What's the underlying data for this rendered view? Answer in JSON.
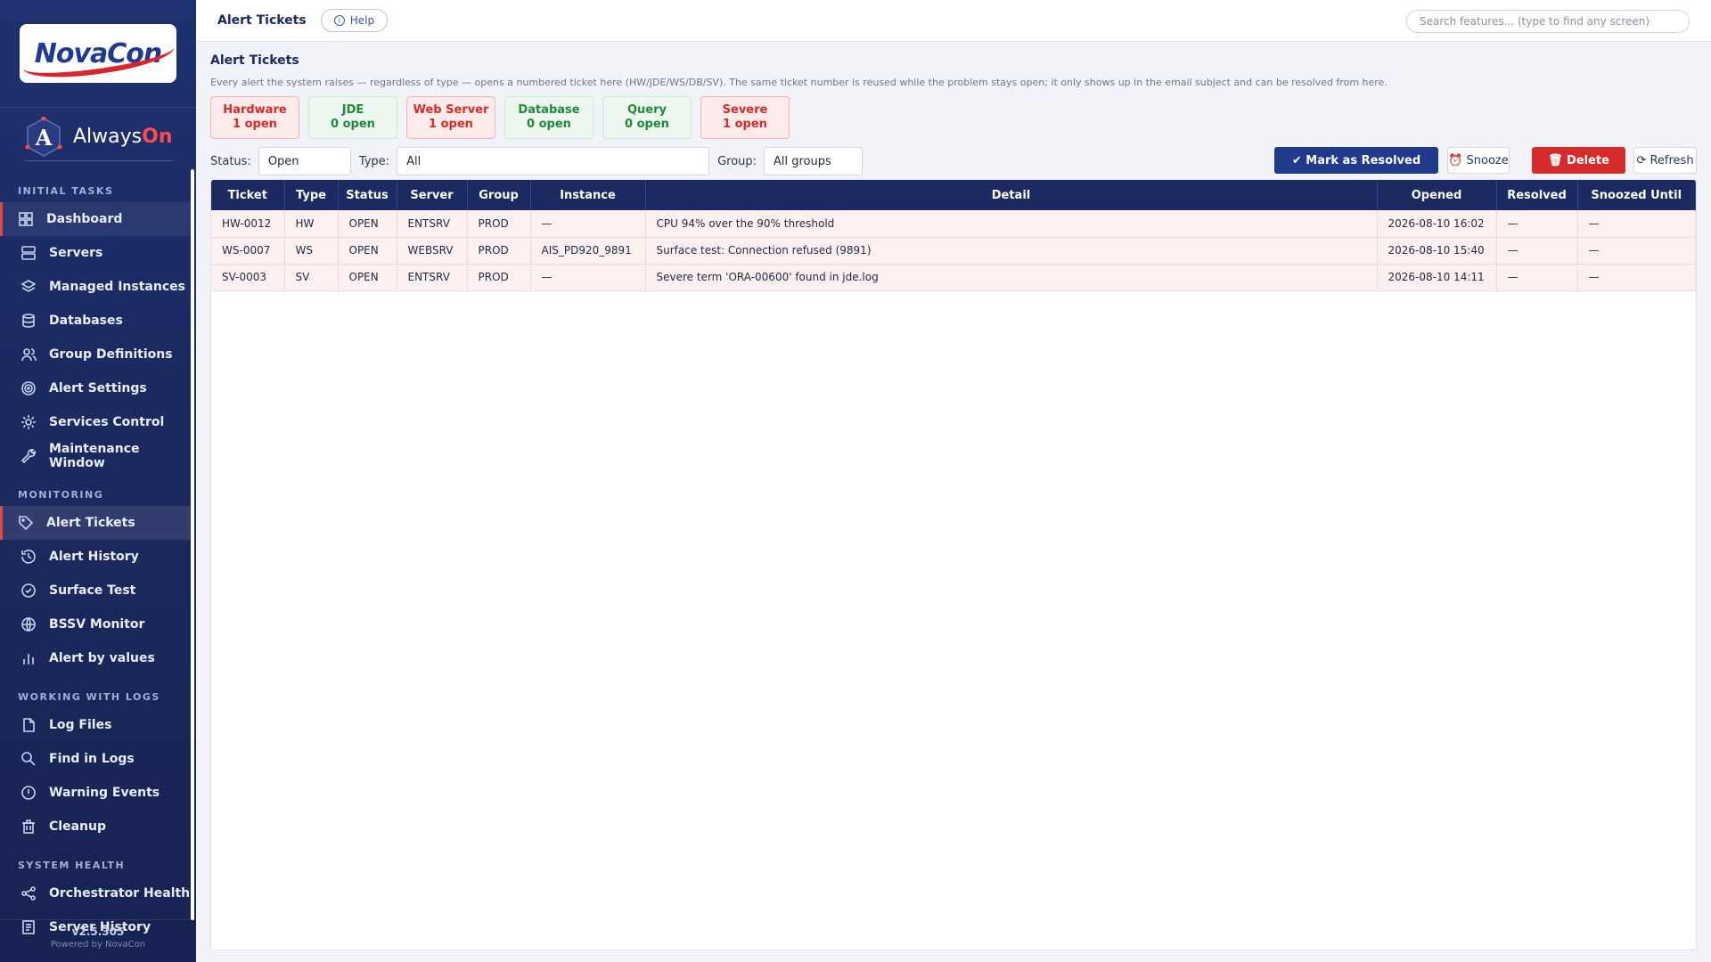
{
  "logo": {
    "text": "NovaCon"
  },
  "brand": {
    "name_main": "Always",
    "name_accent": "On",
    "mark_letter": "A"
  },
  "sidebar": {
    "sections": [
      {
        "title": "INITIAL TASKS",
        "items": [
          {
            "label": "Dashboard",
            "icon": "grid-icon",
            "active": false
          },
          {
            "label": "Servers",
            "icon": "server-icon"
          },
          {
            "label": "Managed Instances",
            "icon": "layers-icon"
          },
          {
            "label": "Databases",
            "icon": "database-icon"
          },
          {
            "label": "Group Definitions",
            "icon": "users-icon"
          },
          {
            "label": "Alert Settings",
            "icon": "target-icon"
          },
          {
            "label": "Services Control",
            "icon": "gear-icon"
          },
          {
            "label": "Maintenance Window",
            "icon": "wrench-icon"
          }
        ]
      },
      {
        "title": "MONITORING",
        "items": [
          {
            "label": "Alert Tickets",
            "icon": "tag-icon",
            "active": true
          },
          {
            "label": "Alert History",
            "icon": "history-icon"
          },
          {
            "label": "Surface Test",
            "icon": "check-circle-icon"
          },
          {
            "label": "BSSV Monitor",
            "icon": "globe-icon"
          },
          {
            "label": "Alert by values",
            "icon": "bar-chart-icon"
          }
        ]
      },
      {
        "title": "WORKING WITH LOGS",
        "items": [
          {
            "label": "Log Files",
            "icon": "file-icon"
          },
          {
            "label": "Find in Logs",
            "icon": "search-file-icon"
          },
          {
            "label": "Warning Events",
            "icon": "alert-circle-icon"
          },
          {
            "label": "Cleanup",
            "icon": "trash-icon"
          }
        ]
      },
      {
        "title": "SYSTEM HEALTH",
        "items": [
          {
            "label": "Orchestrator Health",
            "icon": "share-icon"
          },
          {
            "label": "Server History",
            "icon": "document-icon"
          }
        ]
      }
    ],
    "version": "v2.5.305",
    "powered_by": "Powered by NovaCon"
  },
  "topbar": {
    "title": "Alert Tickets",
    "help_label": "Help",
    "search_placeholder": "Search features... (type to find any screen)"
  },
  "page": {
    "title": "Alert Tickets",
    "description": "Every alert the system raises — regardless of type — opens a numbered ticket here (HW/JDE/WS/DB/SV). The same ticket number is reused while the problem stays open; it only shows up in the email subject and can be resolved from here."
  },
  "cards": [
    {
      "name": "Hardware",
      "count": "1 open",
      "status": "red"
    },
    {
      "name": "JDE",
      "count": "0 open",
      "status": "green"
    },
    {
      "name": "Web Server",
      "count": "1 open",
      "status": "red"
    },
    {
      "name": "Database",
      "count": "0 open",
      "status": "green"
    },
    {
      "name": "Query",
      "count": "0 open",
      "status": "green"
    },
    {
      "name": "Severe",
      "count": "1 open",
      "status": "red"
    }
  ],
  "filters": {
    "status_label": "Status:",
    "status_value": "Open",
    "type_label": "Type:",
    "type_value": "All",
    "group_label": "Group:",
    "group_value": "All groups"
  },
  "actions": {
    "resolve": "✔ Mark as Resolved",
    "snooze": "⏰ Snooze",
    "delete": "🗑 Delete",
    "refresh": "⟳ Refresh"
  },
  "table": {
    "columns": [
      "Ticket",
      "Type",
      "Status",
      "Server",
      "Group",
      "Instance",
      "Detail",
      "Opened",
      "Resolved",
      "Snoozed Until"
    ],
    "rows": [
      [
        "HW-0012",
        "HW",
        "OPEN",
        "ENTSRV",
        "PROD",
        "—",
        "CPU 94% over the 90% threshold",
        "2026-08-10 16:02",
        "—",
        "—"
      ],
      [
        "WS-0007",
        "WS",
        "OPEN",
        "WEBSRV",
        "PROD",
        "AIS_PD920_9891",
        "Surface test: Connection refused (9891)",
        "2026-08-10 15:40",
        "—",
        "—"
      ],
      [
        "SV-0003",
        "SV",
        "OPEN",
        "ENTSRV",
        "PROD",
        "—",
        "Severe term 'ORA-00600' found in jde.log",
        "2026-08-10 14:11",
        "—",
        "—"
      ]
    ]
  },
  "colors": {
    "sidebar": "#1b2a60",
    "accent_red": "#d62b2b",
    "primary": "#1f3a8a"
  }
}
